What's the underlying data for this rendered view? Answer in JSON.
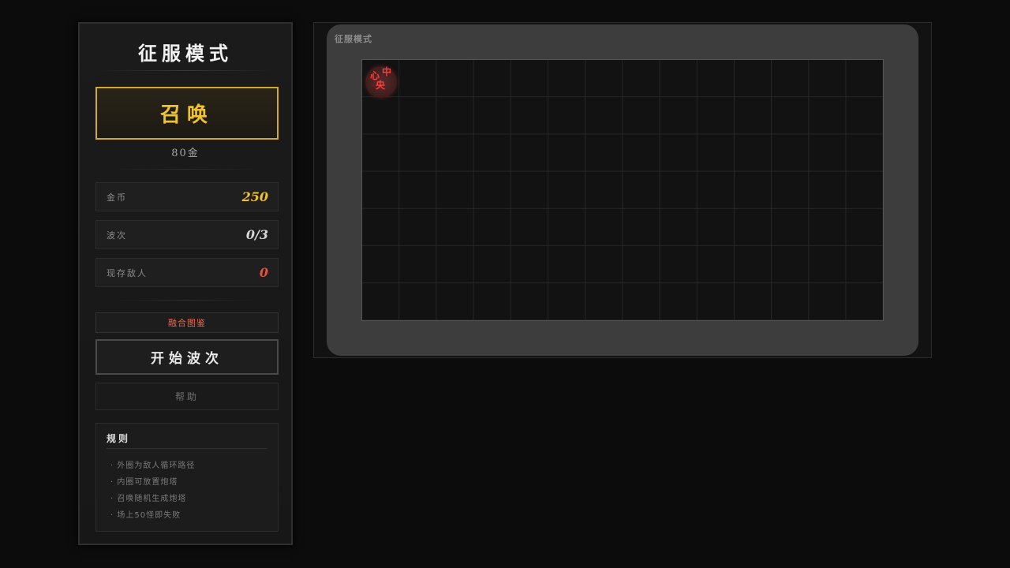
{
  "sidebar": {
    "title": "征服模式",
    "summon": {
      "label": "召唤",
      "cost": "80金"
    },
    "stats": [
      {
        "label": "金币",
        "value": "250",
        "color": "#f0c22c"
      },
      {
        "label": "波次",
        "value": "0/3",
        "color": "#d8d8d8"
      },
      {
        "label": "现存敌人",
        "value": "0",
        "color": "#e0553f"
      }
    ],
    "fusion_label": "融合图鉴",
    "start_label": "开始波次",
    "help_label": "帮助",
    "rules": {
      "title": "规则",
      "items": [
        "· 外圈为敌人循环路径",
        "· 内圈可放置炮塔",
        "· 召唤随机生成炮塔",
        "· 场上50怪即失败"
      ]
    }
  },
  "board": {
    "label": "征服模式",
    "core": {
      "glyph_1": "心",
      "glyph_2": "中",
      "glyph_3": "央"
    }
  },
  "colors": {
    "accent_gold": "#f0c22c",
    "danger_red": "#e0553f",
    "path_gray": "#3d3d3d"
  }
}
